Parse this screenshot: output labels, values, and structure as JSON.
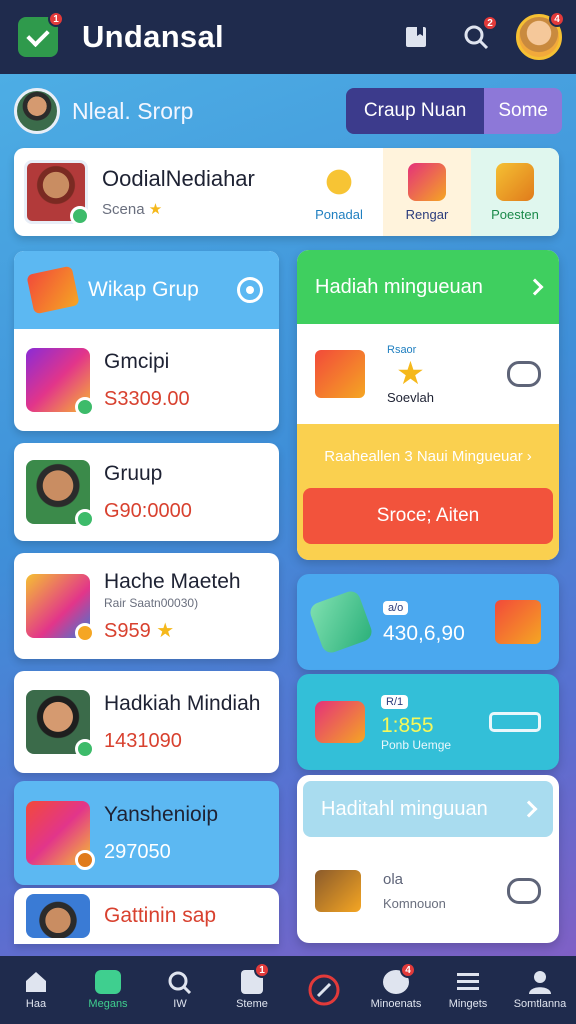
{
  "app": {
    "title": "Undansal",
    "notif_badge": "1",
    "top_badge_2": "2",
    "avatar_badge": "4"
  },
  "profile": {
    "name": "Nleal. Srorp",
    "seg_primary": "Craup Nuan",
    "seg_secondary": "Some"
  },
  "top_card": {
    "name": "OodialNediahar",
    "sub": "Scena",
    "buttons": [
      {
        "label": "Ponadal",
        "color": "#e9f6fb"
      },
      {
        "label": "Rengar",
        "color": "#fff3dc"
      },
      {
        "label": "Poesten",
        "color": "#e0f7ee"
      }
    ]
  },
  "left": {
    "header": "Wikap Grup",
    "items": [
      {
        "title": "Gmcipi",
        "value": "S3309.00"
      },
      {
        "title": "Gruup",
        "value": "G90:0000"
      },
      {
        "title": "Hache Maeteh",
        "sub": "Rair Saatn00030)",
        "value": "S959"
      },
      {
        "title": "Hadkiah Mindiah",
        "value": "1431090"
      },
      {
        "title": "Yanshenioip",
        "value": "297050"
      },
      {
        "title": "Gattinin sap"
      }
    ]
  },
  "right": {
    "panel1_header": "Hadiah mingueuan",
    "panel1_small": "Rsaor",
    "panel1_label": "Soevlah",
    "panel1_strip": "Raaheallen 3 Naui Mingueuar",
    "panel1_button": "Sroce; Aiten",
    "card_blue_tag": "a/o",
    "card_blue_value": "430,6,90",
    "card_teal_tag": "R/1",
    "card_teal_value": "1:855",
    "card_teal_sub": "Ponb Uemge",
    "panel2_header": "Haditahl minguuan",
    "panel2_small": "ola",
    "panel2_label": "Komnouon"
  },
  "bottom_nav": [
    {
      "label": "Haa",
      "icon": "home-icon"
    },
    {
      "label": "Megans",
      "icon": "grid-icon",
      "active": true
    },
    {
      "label": "IW",
      "icon": "search-icon"
    },
    {
      "label": "Steme",
      "icon": "bag-icon",
      "badge": "1"
    },
    {
      "label": "",
      "icon": "compass-icon"
    },
    {
      "label": "Minoenats",
      "icon": "chat-icon",
      "badge": "4"
    },
    {
      "label": "Mingets",
      "icon": "list-icon"
    },
    {
      "label": "Somtlanna",
      "icon": "profile-icon"
    }
  ],
  "colors": {
    "topbar": "#1f2b4d",
    "accent_green": "#3fcf5f",
    "accent_yellow": "#fad04f",
    "accent_red": "#f2533c",
    "accent_blue": "#5cb8f2",
    "value_red": "#d8412f"
  }
}
